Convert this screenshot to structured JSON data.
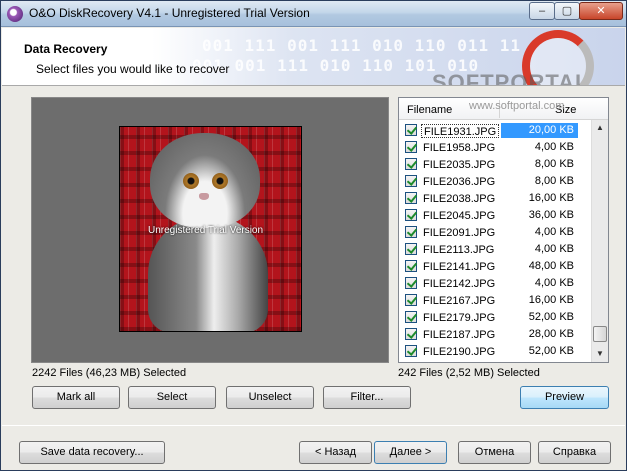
{
  "window": {
    "title": "O&O DiskRecovery V4.1 - Unregistered Trial Version",
    "controls": {
      "minimize": "–",
      "maximize": "▢",
      "close": "✕"
    }
  },
  "header": {
    "title": "Data Recovery",
    "subtitle": "Select files you would like to recover",
    "binary_line1": "001 111 001 111 010 110 011 11",
    "binary_line2": "001 001 111 010 110 101 010",
    "watermark": "SOFTPORTAL",
    "watermark_url": "www.softportal.com"
  },
  "preview": {
    "watermark": "Unregistered Trial Version"
  },
  "file_list": {
    "columns": {
      "name": "Filename",
      "size": "Size"
    },
    "rows": [
      {
        "name": "FILE1931.JPG",
        "size": "20,00 KB",
        "checked": true,
        "selected": true
      },
      {
        "name": "FILE1958.JPG",
        "size": "4,00 KB",
        "checked": true
      },
      {
        "name": "FILE2035.JPG",
        "size": "8,00 KB",
        "checked": true
      },
      {
        "name": "FILE2036.JPG",
        "size": "8,00 KB",
        "checked": true
      },
      {
        "name": "FILE2038.JPG",
        "size": "16,00 KB",
        "checked": true
      },
      {
        "name": "FILE2045.JPG",
        "size": "36,00 KB",
        "checked": true
      },
      {
        "name": "FILE2091.JPG",
        "size": "4,00 KB",
        "checked": true
      },
      {
        "name": "FILE2113.JPG",
        "size": "4,00 KB",
        "checked": true
      },
      {
        "name": "FILE2141.JPG",
        "size": "48,00 KB",
        "checked": true
      },
      {
        "name": "FILE2142.JPG",
        "size": "4,00 KB",
        "checked": true
      },
      {
        "name": "FILE2167.JPG",
        "size": "16,00 KB",
        "checked": true
      },
      {
        "name": "FILE2179.JPG",
        "size": "52,00 KB",
        "checked": true
      },
      {
        "name": "FILE2187.JPG",
        "size": "28,00 KB",
        "checked": true
      },
      {
        "name": "FILE2190.JPG",
        "size": "52,00 KB",
        "checked": true
      }
    ]
  },
  "status": {
    "left": "2242 Files (46,23 MB) Selected",
    "right": "242 Files (2,52 MB) Selected"
  },
  "buttons": {
    "mark_all": "Mark all",
    "select": "Select",
    "unselect": "Unselect",
    "filter": "Filter...",
    "preview": "Preview",
    "save": "Save data recovery...",
    "back": "< Назад",
    "next": "Далее >",
    "cancel": "Отмена",
    "help": "Справка"
  }
}
